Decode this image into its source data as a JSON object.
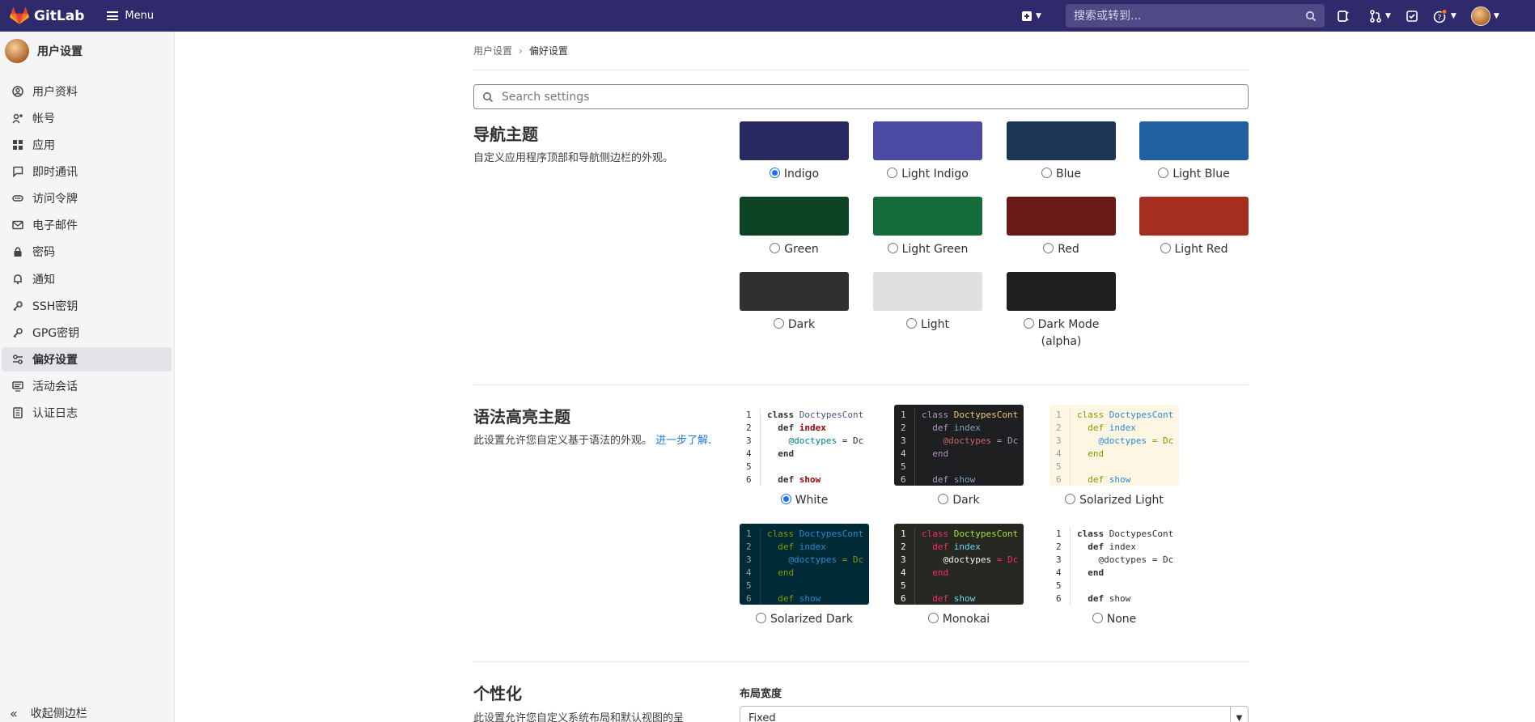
{
  "topbar": {
    "brand": "GitLab",
    "menu_label": "Menu",
    "search_placeholder": "搜索或转到...",
    "bar_color": "#2f2a6b"
  },
  "sidebar": {
    "title": "用户设置",
    "items": [
      {
        "label": "用户资料",
        "icon": "profile-icon"
      },
      {
        "label": "帐号",
        "icon": "account-icon"
      },
      {
        "label": "应用",
        "icon": "applications-icon"
      },
      {
        "label": "即时通讯",
        "icon": "chat-icon"
      },
      {
        "label": "访问令牌",
        "icon": "token-icon"
      },
      {
        "label": "电子邮件",
        "icon": "mail-icon"
      },
      {
        "label": "密码",
        "icon": "lock-icon"
      },
      {
        "label": "通知",
        "icon": "bell-icon"
      },
      {
        "label": "SSH密钥",
        "icon": "key-icon"
      },
      {
        "label": "GPG密钥",
        "icon": "key-icon"
      },
      {
        "label": "偏好设置",
        "icon": "preferences-icon",
        "active": true
      },
      {
        "label": "活动会话",
        "icon": "monitor-icon"
      },
      {
        "label": "认证日志",
        "icon": "log-icon"
      }
    ],
    "collapse_label": "收起侧边栏"
  },
  "breadcrumb": {
    "parent": "用户设置",
    "current": "偏好设置"
  },
  "search": {
    "placeholder": "Search settings"
  },
  "nav_theme": {
    "title": "导航主题",
    "description": "自定义应用程序顶部和导航侧边栏的外观。",
    "themes": [
      {
        "label": "Indigo",
        "color": "#292961",
        "selected": true
      },
      {
        "label": "Light Indigo",
        "color": "#4b4ba3"
      },
      {
        "label": "Blue",
        "color": "#1a3652"
      },
      {
        "label": "Light Blue",
        "color": "#2261a1"
      },
      {
        "label": "Green",
        "color": "#0d4524"
      },
      {
        "label": "Light Green",
        "color": "#156b39"
      },
      {
        "label": "Red",
        "color": "#691a16"
      },
      {
        "label": "Light Red",
        "color": "#a62e21"
      },
      {
        "label": "Dark",
        "color": "#303030"
      },
      {
        "label": "Light",
        "color": "#dfdfdf"
      },
      {
        "label": "Dark Mode (alpha)",
        "color": "#1f1f1f"
      }
    ]
  },
  "syntax_theme": {
    "title": "语法高亮主题",
    "description": "此设置允许您自定义基于语法的外观。",
    "learn_more": "进一步了解",
    "period": ".",
    "code_lines": [
      "class DoctypesCont",
      "  def index",
      "    @doctypes = Dc",
      "  end",
      "",
      "  def show"
    ],
    "themes": [
      {
        "label": "White",
        "selected": true
      },
      {
        "label": "Dark"
      },
      {
        "label": "Solarized Light"
      },
      {
        "label": "Solarized Dark"
      },
      {
        "label": "Monokai"
      },
      {
        "label": "None"
      }
    ]
  },
  "personalization": {
    "title": "个性化",
    "description": "此设置允许您自定义系统布局和默认视图的呈",
    "layout_width_label": "布局宽度",
    "layout_width_value": "Fixed"
  }
}
